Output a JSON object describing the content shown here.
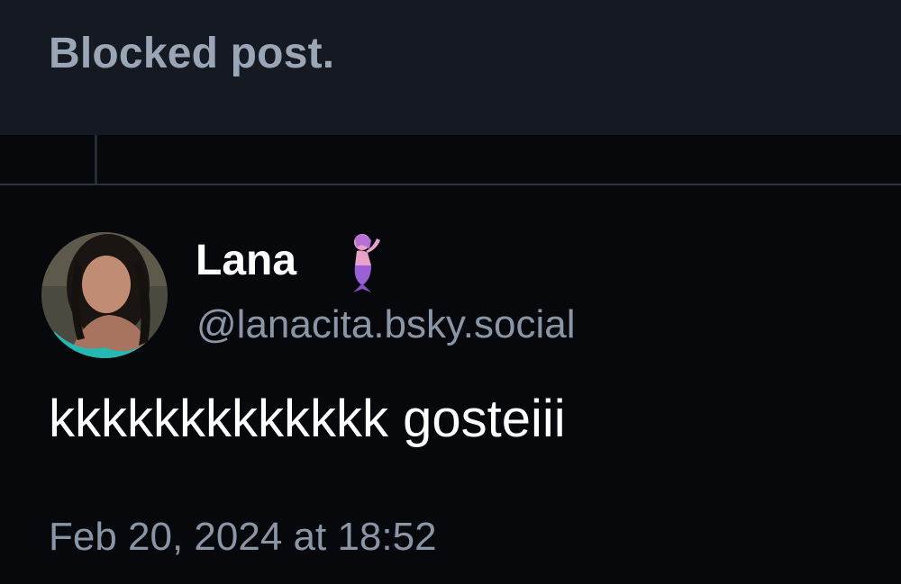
{
  "blocked_post": {
    "label": "Blocked post."
  },
  "post": {
    "author": {
      "display_name": "Lana",
      "emoji": "mermaid-emoji",
      "handle": "@lanacita.bsky.social"
    },
    "text": "kkkkkkkkkkkkk gosteiii",
    "timestamp": "Feb 20, 2024 at 18:52"
  },
  "colors": {
    "background": "#06080c",
    "blocked_card": "#151a22",
    "muted_text": "#8a96a6",
    "primary_text": "#ffffff"
  }
}
